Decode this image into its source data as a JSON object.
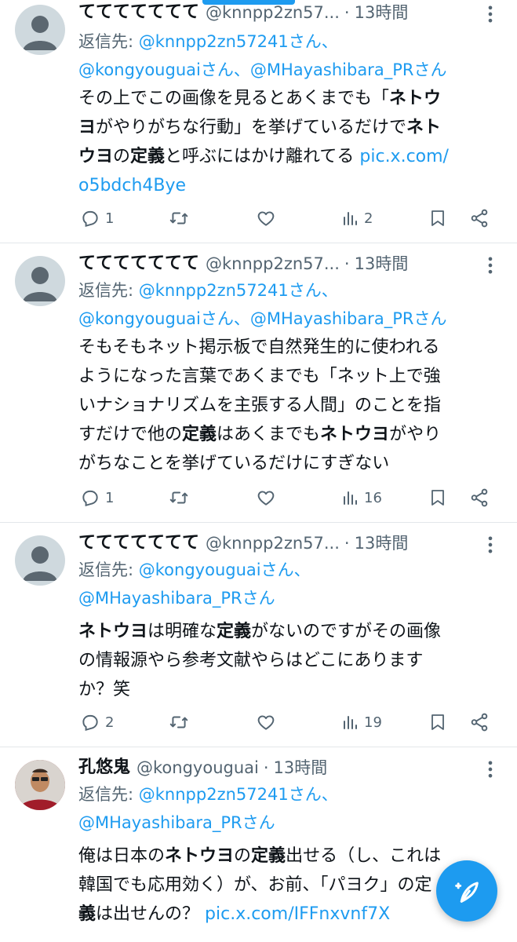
{
  "tweets": [
    {
      "name": "ててててててて",
      "handle": "@knnpp2zn57...",
      "time": "13時間",
      "reply_label": "返信先:",
      "mentions_line1": "@knnpp2zn57241さん、",
      "mentions_line2": "@kongyouguaiさん、@MHayashibara_PRさん",
      "text_lines": [
        [
          "その上でこの画像を見るとあくまでも「",
          "ネトウ",
          ""
        ],
        [
          "ヨ",
          "がやりがちな行動」を挙げているだけで",
          "ネト"
        ],
        [
          "ウヨ",
          "の",
          "定義",
          "と呼ぶにはかけ離れてる"
        ],
        [
          "o5bdch4Bye"
        ]
      ],
      "link_part1": "pic.x.com/",
      "link_part2": "o5bdch4Bye",
      "replies": "1",
      "views": "2"
    },
    {
      "name": "ててててててて",
      "handle": "@knnpp2zn57...",
      "time": "13時間",
      "reply_label": "返信先:",
      "mentions_line1": "@knnpp2zn57241さん、",
      "mentions_line2": "@kongyouguaiさん、@MHayashibara_PRさん",
      "line1": "そもそもネット掲示板で自然発生的に使われる",
      "line2": "ようになった言葉であくまでも「ネット上で強",
      "line3": "いナショナリズムを主張する人間」のことを指",
      "line4a": "すだけで他の",
      "line4b": "定義",
      "line4c": "はあくまでも",
      "line4d": "ネトウヨ",
      "line4e": "がやり",
      "line5": "がちなことを挙げているだけにすぎない",
      "replies": "1",
      "views": "16"
    },
    {
      "name": "ててててててて",
      "handle": "@knnpp2zn57...",
      "time": "13時間",
      "reply_label": "返信先:",
      "mentions_line1": "@kongyouguaiさん、",
      "mentions_line2": "@MHayashibara_PRさん",
      "line1a": "ネトウヨ",
      "line1b": "は明確な",
      "line1c": "定義",
      "line1d": "がないのですがその画像",
      "line2": "の情報源やら参考文献やらはどこにあります",
      "line3": "か？笑",
      "replies": "2",
      "views": "19"
    },
    {
      "name": "孔悠鬼",
      "handle": "@kongyouguai",
      "time": "13時間",
      "reply_label": "返信先:",
      "mentions_line1": "@knnpp2zn57241さん、",
      "mentions_line2": "@MHayashibara_PRさん",
      "line1a": "俺は日本の",
      "line1b": "ネトウヨ",
      "line1c": "の",
      "line1d": "定義",
      "line1e": "出せる（し、これは",
      "line2": "韓国でも応用効く）が、お前、「パヨク」の定",
      "line3a": "義",
      "line3b": "は出せんの？",
      "link": "pic.x.com/IFFnxvnf7X"
    }
  ],
  "t1": {
    "l1a": "その上でこの画像を見るとあくまでも「",
    "l1b": "ネトウ",
    "l2a": "ヨ",
    "l2b": "がやりがちな行動」を挙げているだけで",
    "l2c": "ネト",
    "l3a": "ウヨ",
    "l3b": "の",
    "l3c": "定義",
    "l3d": "と呼ぶにはかけ離れてる",
    "l3link": "pic.x.com/",
    "l4link": "o5bdch4Bye"
  },
  "colors": {
    "accent": "#1d9bf0",
    "text": "#0f1419",
    "secondary": "#536471",
    "divider": "#e3e7ea"
  },
  "icons": {
    "reply": "reply-icon",
    "retweet": "retweet-icon",
    "like": "heart-icon",
    "views": "views-icon",
    "bookmark": "bookmark-icon",
    "share": "share-icon",
    "more": "more-icon",
    "compose": "compose-icon"
  }
}
